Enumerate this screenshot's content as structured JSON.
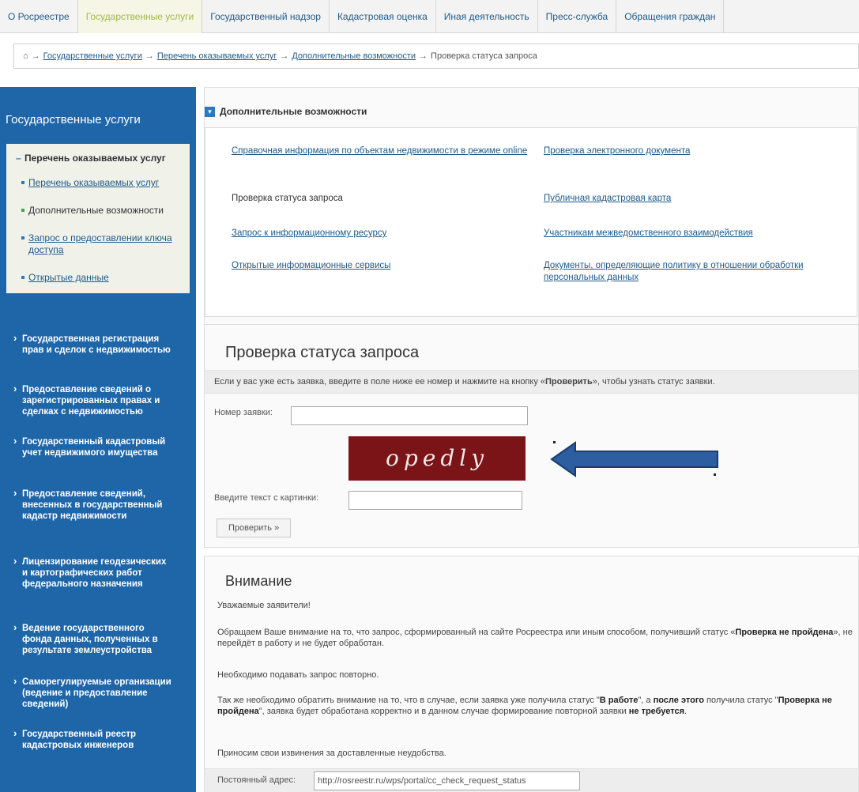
{
  "top_nav": {
    "tabs": [
      {
        "label": "О Росреестре",
        "active": false
      },
      {
        "label": "Государственные услуги",
        "active": true
      },
      {
        "label": "Государственный надзор",
        "active": false
      },
      {
        "label": "Кадастровая оценка",
        "active": false
      },
      {
        "label": "Иная деятельность",
        "active": false
      },
      {
        "label": "Пресс-служба",
        "active": false
      },
      {
        "label": "Обращения граждан",
        "active": false
      }
    ]
  },
  "breadcrumb": {
    "items": [
      "Государственные услуги",
      "Перечень оказываемых услуг",
      "Дополнительные возможности"
    ],
    "current": "Проверка статуса запроса"
  },
  "sidebar": {
    "title": "Государственные услуги",
    "section_title": "Перечень оказываемых услуг",
    "sub_items": [
      "Перечень оказываемых услуг",
      "Дополнительные возможности",
      "Запрос о предоставлении ключа доступа",
      "Открытые данные"
    ],
    "items": [
      "Государственная регистрация прав и сделок с недвижимостью",
      "Предоставление сведений о зарегистрированных правах и сделках с недвижимостью",
      "Государственный кадастровый учет недвижимого имущества",
      "Предоставление сведений, внесенных в государственный кадастр недвижимости",
      "Лицензирование геодезических и картографических работ федерального назначения",
      "Ведение государственного фонда данных, полученных в результате землеустройства",
      "Саморегулируемые организации (ведение и предоставление сведений)",
      "Государственный реестр кадастровых инженеров"
    ]
  },
  "extra": {
    "title": "Дополнительные возможности",
    "links": [
      "Справочная информация по объектам недвижимости в режиме online",
      "Проверка электронного документа",
      "Проверка статуса запроса",
      "Публичная кадастровая карта",
      "Запрос к информационному ресурсу",
      "Участникам межведомственного взаимодействия",
      "Открытые информационные сервисы",
      "Документы, определяющие политику в отношении обработки персональных данных"
    ]
  },
  "check": {
    "title": "Проверка статуса запроса",
    "desc_pre": "Если у вас уже есть заявка, введите в поле ниже ее номер и нажмите на кнопку «",
    "desc_bold": "Проверить",
    "desc_post": "», чтобы узнать статус заявки.",
    "order_label": "Номер заявки:",
    "order_value": "",
    "captcha_text": "opedly",
    "captcha_label": "Введите текст с картинки:",
    "captcha_value": "",
    "button_label": "Проверить »"
  },
  "attention": {
    "title": "Внимание",
    "greeting": "Уважаемые заявители!",
    "p1_pre": "Обращаем Ваше внимание на то, что запрос, сформированный на сайте Росреестра или иным способом, получивший статус «",
    "p1_bold": "Проверка не пройдена",
    "p1_post": "», не перейдёт в работу и не будет обработан.",
    "p2": "Необходимо подавать запрос повторно.",
    "p3_a": "Так же необходимо обратить внимание на то, что в случае, если заявка уже получила статус \"",
    "p3_b": "В работе",
    "p3_c": "\", а ",
    "p3_d": "после этого",
    "p3_e": " получила статус \"",
    "p3_f": "Проверка не пройдена",
    "p3_g": "\", заявка будет обработана корректно и в данном случае формирование повторной заявки ",
    "p3_h": "не требуется",
    "p3_i": ".",
    "p4": "Приносим свои извинения за доставленные неудобства."
  },
  "permalink": {
    "label": "Постоянный адрес:",
    "value": "http://rosreestr.ru/wps/portal/cc_check_request_status"
  },
  "colors": {
    "sidebar_bg": "#1f66a8",
    "link": "#1f5a8a",
    "active_tab": "#9fb84a",
    "captcha_bg": "#7a1417",
    "arrow_fill": "#2c5ea0"
  }
}
